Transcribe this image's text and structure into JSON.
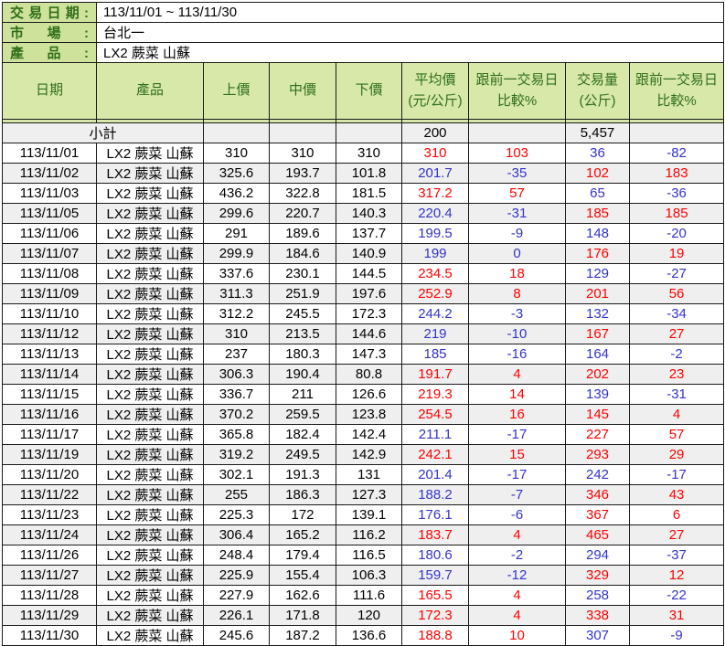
{
  "info": [
    {
      "label": "交易日期:",
      "value": "113/11/01 ~ 113/11/30"
    },
    {
      "label": "市場:",
      "value": "台北一"
    },
    {
      "label": "產品:",
      "value": "LX2 蕨菜 山蘇"
    }
  ],
  "columns": [
    "日期",
    "產品",
    "上價",
    "中價",
    "下價",
    "平均價\n(元/公斤)",
    "跟前一交易日\n比較%",
    "交易量\n(公斤)",
    "跟前一交易日\n比較%"
  ],
  "subtotal": {
    "label": "小計",
    "avg": "200",
    "volume": "5,457"
  },
  "rows": [
    {
      "date": "113/11/01",
      "product": "LX2 蕨菜 山蘇",
      "upper": "310",
      "middle": "310",
      "lower": "310",
      "avg": "310",
      "avg_c": "red",
      "chg1": "103",
      "chg1_c": "red",
      "vol": "36",
      "vol_c": "blue",
      "chg2": "-82",
      "chg2_c": "blue"
    },
    {
      "date": "113/11/02",
      "product": "LX2 蕨菜 山蘇",
      "upper": "325.6",
      "middle": "193.7",
      "lower": "101.8",
      "avg": "201.7",
      "avg_c": "blue",
      "chg1": "-35",
      "chg1_c": "blue",
      "vol": "102",
      "vol_c": "red",
      "chg2": "183",
      "chg2_c": "red"
    },
    {
      "date": "113/11/03",
      "product": "LX2 蕨菜 山蘇",
      "upper": "436.2",
      "middle": "322.8",
      "lower": "181.5",
      "avg": "317.2",
      "avg_c": "red",
      "chg1": "57",
      "chg1_c": "red",
      "vol": "65",
      "vol_c": "blue",
      "chg2": "-36",
      "chg2_c": "blue"
    },
    {
      "date": "113/11/05",
      "product": "LX2 蕨菜 山蘇",
      "upper": "299.6",
      "middle": "220.7",
      "lower": "140.3",
      "avg": "220.4",
      "avg_c": "blue",
      "chg1": "-31",
      "chg1_c": "blue",
      "vol": "185",
      "vol_c": "red",
      "chg2": "185",
      "chg2_c": "red"
    },
    {
      "date": "113/11/06",
      "product": "LX2 蕨菜 山蘇",
      "upper": "291",
      "middle": "189.6",
      "lower": "137.7",
      "avg": "199.5",
      "avg_c": "blue",
      "chg1": "-9",
      "chg1_c": "blue",
      "vol": "148",
      "vol_c": "blue",
      "chg2": "-20",
      "chg2_c": "blue"
    },
    {
      "date": "113/11/07",
      "product": "LX2 蕨菜 山蘇",
      "upper": "299.9",
      "middle": "184.6",
      "lower": "140.9",
      "avg": "199",
      "avg_c": "blue",
      "chg1": "0",
      "chg1_c": "blue",
      "vol": "176",
      "vol_c": "red",
      "chg2": "19",
      "chg2_c": "red"
    },
    {
      "date": "113/11/08",
      "product": "LX2 蕨菜 山蘇",
      "upper": "337.6",
      "middle": "230.1",
      "lower": "144.5",
      "avg": "234.5",
      "avg_c": "red",
      "chg1": "18",
      "chg1_c": "red",
      "vol": "129",
      "vol_c": "blue",
      "chg2": "-27",
      "chg2_c": "blue"
    },
    {
      "date": "113/11/09",
      "product": "LX2 蕨菜 山蘇",
      "upper": "311.3",
      "middle": "251.9",
      "lower": "197.6",
      "avg": "252.9",
      "avg_c": "red",
      "chg1": "8",
      "chg1_c": "red",
      "vol": "201",
      "vol_c": "red",
      "chg2": "56",
      "chg2_c": "red"
    },
    {
      "date": "113/11/10",
      "product": "LX2 蕨菜 山蘇",
      "upper": "312.2",
      "middle": "245.5",
      "lower": "172.3",
      "avg": "244.2",
      "avg_c": "blue",
      "chg1": "-3",
      "chg1_c": "blue",
      "vol": "132",
      "vol_c": "blue",
      "chg2": "-34",
      "chg2_c": "blue"
    },
    {
      "date": "113/11/12",
      "product": "LX2 蕨菜 山蘇",
      "upper": "310",
      "middle": "213.5",
      "lower": "144.6",
      "avg": "219",
      "avg_c": "blue",
      "chg1": "-10",
      "chg1_c": "blue",
      "vol": "167",
      "vol_c": "red",
      "chg2": "27",
      "chg2_c": "red"
    },
    {
      "date": "113/11/13",
      "product": "LX2 蕨菜 山蘇",
      "upper": "237",
      "middle": "180.3",
      "lower": "147.3",
      "avg": "185",
      "avg_c": "blue",
      "chg1": "-16",
      "chg1_c": "blue",
      "vol": "164",
      "vol_c": "blue",
      "chg2": "-2",
      "chg2_c": "blue"
    },
    {
      "date": "113/11/14",
      "product": "LX2 蕨菜 山蘇",
      "upper": "306.3",
      "middle": "190.4",
      "lower": "80.8",
      "avg": "191.7",
      "avg_c": "red",
      "chg1": "4",
      "chg1_c": "red",
      "vol": "202",
      "vol_c": "red",
      "chg2": "23",
      "chg2_c": "red"
    },
    {
      "date": "113/11/15",
      "product": "LX2 蕨菜 山蘇",
      "upper": "336.7",
      "middle": "211",
      "lower": "126.6",
      "avg": "219.3",
      "avg_c": "red",
      "chg1": "14",
      "chg1_c": "red",
      "vol": "139",
      "vol_c": "blue",
      "chg2": "-31",
      "chg2_c": "blue"
    },
    {
      "date": "113/11/16",
      "product": "LX2 蕨菜 山蘇",
      "upper": "370.2",
      "middle": "259.5",
      "lower": "123.8",
      "avg": "254.5",
      "avg_c": "red",
      "chg1": "16",
      "chg1_c": "red",
      "vol": "145",
      "vol_c": "red",
      "chg2": "4",
      "chg2_c": "red"
    },
    {
      "date": "113/11/17",
      "product": "LX2 蕨菜 山蘇",
      "upper": "365.8",
      "middle": "182.4",
      "lower": "142.4",
      "avg": "211.1",
      "avg_c": "blue",
      "chg1": "-17",
      "chg1_c": "blue",
      "vol": "227",
      "vol_c": "red",
      "chg2": "57",
      "chg2_c": "red"
    },
    {
      "date": "113/11/19",
      "product": "LX2 蕨菜 山蘇",
      "upper": "319.2",
      "middle": "249.5",
      "lower": "142.9",
      "avg": "242.1",
      "avg_c": "red",
      "chg1": "15",
      "chg1_c": "red",
      "vol": "293",
      "vol_c": "red",
      "chg2": "29",
      "chg2_c": "red"
    },
    {
      "date": "113/11/20",
      "product": "LX2 蕨菜 山蘇",
      "upper": "302.1",
      "middle": "191.3",
      "lower": "131",
      "avg": "201.4",
      "avg_c": "blue",
      "chg1": "-17",
      "chg1_c": "blue",
      "vol": "242",
      "vol_c": "blue",
      "chg2": "-17",
      "chg2_c": "blue"
    },
    {
      "date": "113/11/22",
      "product": "LX2 蕨菜 山蘇",
      "upper": "255",
      "middle": "186.3",
      "lower": "127.3",
      "avg": "188.2",
      "avg_c": "blue",
      "chg1": "-7",
      "chg1_c": "blue",
      "vol": "346",
      "vol_c": "red",
      "chg2": "43",
      "chg2_c": "red"
    },
    {
      "date": "113/11/23",
      "product": "LX2 蕨菜 山蘇",
      "upper": "225.3",
      "middle": "172",
      "lower": "139.1",
      "avg": "176.1",
      "avg_c": "blue",
      "chg1": "-6",
      "chg1_c": "blue",
      "vol": "367",
      "vol_c": "red",
      "chg2": "6",
      "chg2_c": "red"
    },
    {
      "date": "113/11/24",
      "product": "LX2 蕨菜 山蘇",
      "upper": "306.4",
      "middle": "165.2",
      "lower": "116.2",
      "avg": "183.7",
      "avg_c": "red",
      "chg1": "4",
      "chg1_c": "red",
      "vol": "465",
      "vol_c": "red",
      "chg2": "27",
      "chg2_c": "red"
    },
    {
      "date": "113/11/26",
      "product": "LX2 蕨菜 山蘇",
      "upper": "248.4",
      "middle": "179.4",
      "lower": "116.5",
      "avg": "180.6",
      "avg_c": "blue",
      "chg1": "-2",
      "chg1_c": "blue",
      "vol": "294",
      "vol_c": "blue",
      "chg2": "-37",
      "chg2_c": "blue"
    },
    {
      "date": "113/11/27",
      "product": "LX2 蕨菜 山蘇",
      "upper": "225.9",
      "middle": "155.4",
      "lower": "106.3",
      "avg": "159.7",
      "avg_c": "blue",
      "chg1": "-12",
      "chg1_c": "blue",
      "vol": "329",
      "vol_c": "red",
      "chg2": "12",
      "chg2_c": "red"
    },
    {
      "date": "113/11/28",
      "product": "LX2 蕨菜 山蘇",
      "upper": "227.9",
      "middle": "162.6",
      "lower": "111.6",
      "avg": "165.5",
      "avg_c": "red",
      "chg1": "4",
      "chg1_c": "red",
      "vol": "258",
      "vol_c": "blue",
      "chg2": "-22",
      "chg2_c": "blue"
    },
    {
      "date": "113/11/29",
      "product": "LX2 蕨菜 山蘇",
      "upper": "226.1",
      "middle": "171.8",
      "lower": "120",
      "avg": "172.3",
      "avg_c": "red",
      "chg1": "4",
      "chg1_c": "red",
      "vol": "338",
      "vol_c": "red",
      "chg2": "31",
      "chg2_c": "red"
    },
    {
      "date": "113/11/30",
      "product": "LX2 蕨菜 山蘇",
      "upper": "245.6",
      "middle": "187.2",
      "lower": "136.6",
      "avg": "188.8",
      "avg_c": "red",
      "chg1": "10",
      "chg1_c": "red",
      "vol": "307",
      "vol_c": "blue",
      "chg2": "-9",
      "chg2_c": "blue"
    }
  ],
  "colors": {
    "price_up_red": "#ff0000",
    "price_down_blue": "#3333cc",
    "label_green_bg": "#cfe29c",
    "header_green_bg": "#d7e8a9",
    "dark_green_text": "#2f6e1a",
    "stripe_gray": "#efefef",
    "border_black": "#1a1a1a"
  }
}
